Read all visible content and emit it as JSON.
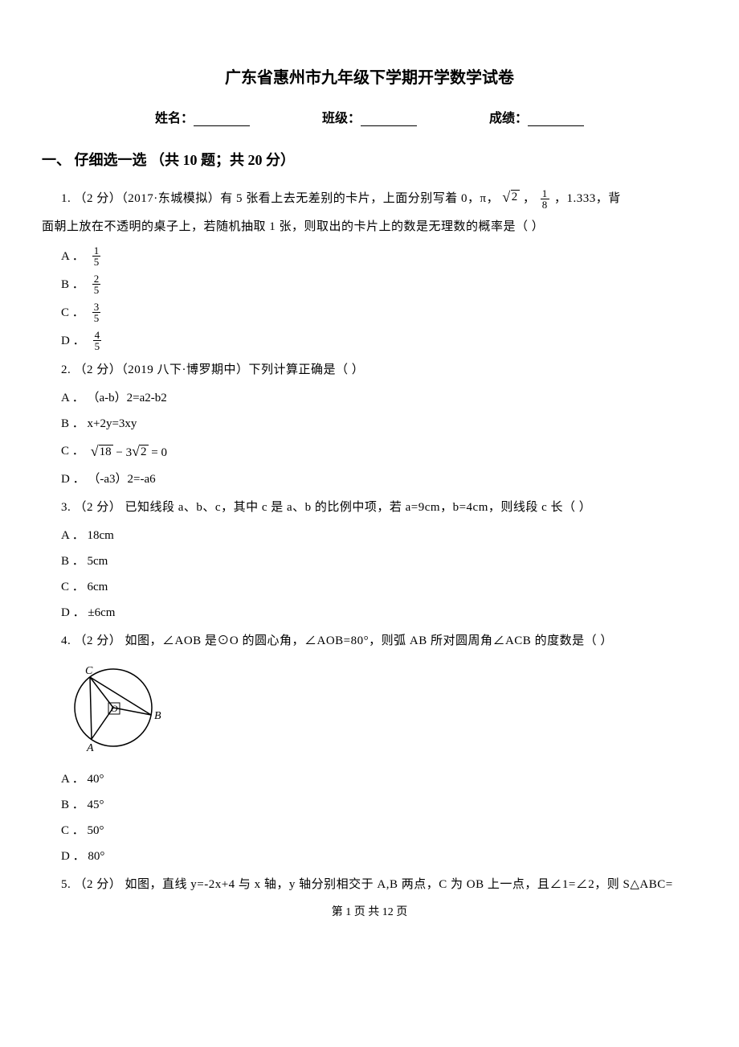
{
  "title": "广东省惠州市九年级下学期开学数学试卷",
  "form": {
    "name_label": "姓名：",
    "class_label": "班级：",
    "score_label": "成绩："
  },
  "section": {
    "heading": "一、 仔细选一选 （共 10 题；共 20 分）"
  },
  "q1": {
    "prefix": "1. （2 分）（2017·东城模拟）有 5 张看上去无差别的卡片，上面分别写着 0，π，",
    "mid1": " ，",
    "mid2": " ，1.333，背",
    "line2": "面朝上放在不透明的桌子上，若随机抽取 1 张，则取出的卡片上的数是无理数的概率是（    ）",
    "opts": {
      "A": "A ．",
      "B": "B ．",
      "C": "C ．",
      "D": "D ．"
    },
    "fracs": {
      "n18": "1",
      "d18": "8",
      "nA": "1",
      "dA": "5",
      "nB": "2",
      "dB": "5",
      "nC": "3",
      "dC": "5",
      "nD": "4",
      "dD": "5"
    },
    "sqrt2_r": "2"
  },
  "q2": {
    "line": "2. （2 分）（2019 八下·博罗期中）下列计算正确是（    ）",
    "A": "A ． （a‐b）2=a2‐b2",
    "B": "B ．  x+2y=3xy",
    "C_prefix": "C ．  ",
    "D": "D ． （‐a3）2=‐a6",
    "sqrt18": "18",
    "sqrt2": "2",
    "C_mid": " − 3",
    "C_suffix": " = 0"
  },
  "q3": {
    "line": "3. （2 分）  已知线段 a、b、c，其中 c 是 a、b 的比例中项，若 a=9cm，b=4cm，则线段 c 长（    ）",
    "A": "A ． 18cm",
    "B": "B ． 5cm",
    "C": "C ． 6cm",
    "D": "D ． ±6cm"
  },
  "q4": {
    "line": "4. （2 分）  如图，∠AOB 是⊙O 的圆心角，∠AOB=80°，则弧 AB 所对圆周角∠ACB 的度数是（    ）",
    "A": "A ． 40°",
    "B": "B ． 45°",
    "C": "C ． 50°",
    "D": "D ． 80°",
    "fig": {
      "C": "C",
      "O": "O",
      "A": "A",
      "B": "B"
    }
  },
  "q5": {
    "line": "5. （2 分）  如图，直线 y=-2x+4 与 x 轴，y 轴分别相交于 A,B 两点，C 为 OB 上一点，且∠1=∠2，则 S△ABC="
  },
  "footer": {
    "text": "第 1 页 共 12 页"
  }
}
